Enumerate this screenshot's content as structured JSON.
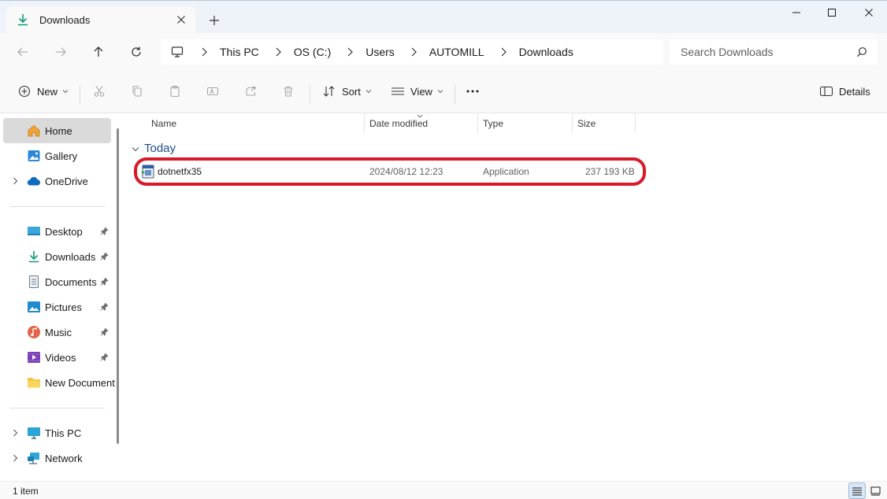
{
  "window": {
    "tab_title": "Downloads",
    "icons": {
      "tab": "download-icon",
      "close_tab": "close-icon",
      "new_tab": "plus-icon",
      "minimize": "minimize-icon",
      "maximize": "maximize-icon",
      "close": "close-icon"
    }
  },
  "navigation": {
    "back": "arrow-left-icon",
    "forward": "arrow-right-icon",
    "up": "arrow-up-icon",
    "refresh": "refresh-icon"
  },
  "address_bar": {
    "root_icon": "monitor-icon",
    "breadcrumbs": [
      "This PC",
      "OS (C:)",
      "Users",
      "AUTOMILL",
      "Downloads"
    ]
  },
  "search": {
    "placeholder": "Search Downloads",
    "icon": "search-icon"
  },
  "toolbar": {
    "new_label": "New",
    "sort_label": "Sort",
    "view_label": "View",
    "details_label": "Details",
    "disabled_actions": [
      "cut",
      "copy",
      "paste",
      "rename",
      "share",
      "delete"
    ]
  },
  "sidebar": {
    "top_items": [
      {
        "label": "Home",
        "icon": "home-icon",
        "selected": true
      },
      {
        "label": "Gallery",
        "icon": "gallery-icon"
      },
      {
        "label": "OneDrive",
        "icon": "cloud-icon",
        "expandable": true
      }
    ],
    "pinned_items": [
      {
        "label": "Desktop",
        "icon": "desktop-icon"
      },
      {
        "label": "Downloads",
        "icon": "download-icon"
      },
      {
        "label": "Documents",
        "icon": "document-icon"
      },
      {
        "label": "Pictures",
        "icon": "pictures-icon"
      },
      {
        "label": "Music",
        "icon": "music-icon"
      },
      {
        "label": "Videos",
        "icon": "video-icon"
      },
      {
        "label": "New Document",
        "icon": "folder-icon"
      }
    ],
    "bottom_items": [
      {
        "label": "This PC",
        "icon": "monitor-icon",
        "expandable": true
      },
      {
        "label": "Network",
        "icon": "network-icon",
        "expandable": true
      }
    ]
  },
  "file_list": {
    "columns": [
      "Name",
      "Date modified",
      "Type",
      "Size"
    ],
    "group_label": "Today",
    "rows": [
      {
        "name": "dotnetfx35",
        "date_modified": "2024/08/12 12:23",
        "type": "Application",
        "size": "237 193 KB",
        "highlighted": true
      }
    ]
  },
  "status_bar": {
    "item_count": "1 item"
  },
  "colors": {
    "accent": "#0067c0",
    "highlight_outline": "#d8192a",
    "group_header": "#1f4c8f",
    "download_green": "#0f9b7a"
  }
}
